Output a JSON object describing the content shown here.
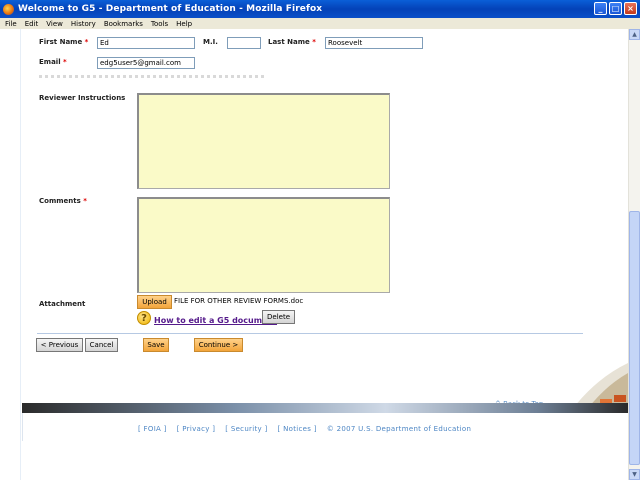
{
  "window": {
    "title": "Welcome to G5 - Department of Education - Mozilla Firefox",
    "minimize": "_",
    "maximize": "□",
    "close": "×"
  },
  "menu": [
    "File",
    "Edit",
    "View",
    "History",
    "Bookmarks",
    "Tools",
    "Help"
  ],
  "form": {
    "first_name_label": "First Name",
    "first_name_value": "Ed",
    "mi_label": "M.I.",
    "mi_value": "",
    "last_name_label": "Last Name",
    "last_name_value": "Roosevelt",
    "email_label": "Email",
    "email_value": "edg5user5@gmail.com",
    "reviewer_instructions_label": "Reviewer Instructions",
    "comments_label": "Comments",
    "attachment_label": "Attachment",
    "required_mark": "*",
    "upload_label": "Upload",
    "file_name": "FILE FOR OTHER REVIEW FORMS.doc",
    "help_link": "How to edit a G5 document",
    "delete_label": "Delete"
  },
  "nav": {
    "previous_label": "< Previous",
    "cancel_label": "Cancel",
    "save_label": "Save",
    "continue_label": "Continue >"
  },
  "footer": {
    "back_to_top": "^ Back to Top",
    "links": [
      "[ FOIA ]",
      "[ Privacy ]",
      "[ Security ]",
      "[ Notices ]"
    ],
    "copyright": "© 2007 U.S. Department of Education"
  },
  "colors": {
    "textarea_bg": "#fafac8",
    "orange_button": "#f2a43a",
    "link_blue": "#4d86c4"
  },
  "icons": {
    "app": "firefox-icon",
    "help": "question-icon"
  }
}
